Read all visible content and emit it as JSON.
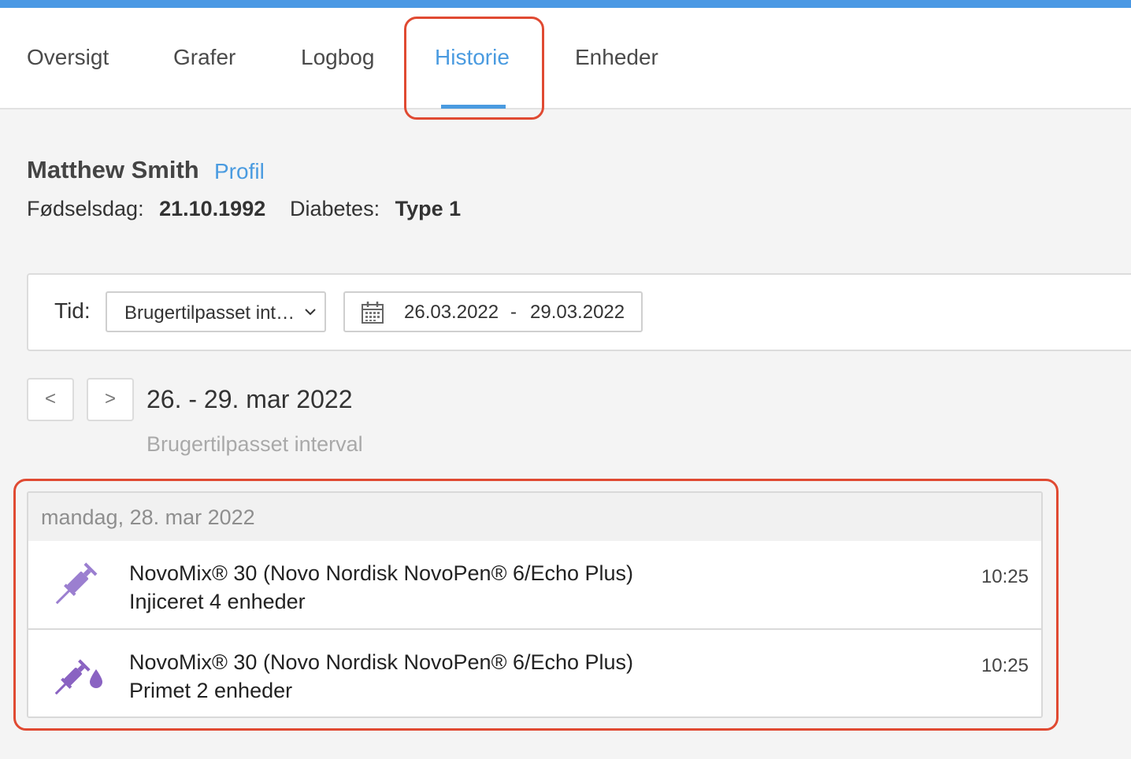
{
  "nav": {
    "tabs": [
      {
        "label": "Oversigt"
      },
      {
        "label": "Grafer"
      },
      {
        "label": "Logbog"
      },
      {
        "label": "Historie"
      },
      {
        "label": "Enheder"
      }
    ],
    "active_tab": "Historie"
  },
  "patient": {
    "name": "Matthew Smith",
    "profile_link": "Profil",
    "birthday_label": "Fødselsdag:",
    "birthday": "21.10.1992",
    "diabetes_label": "Diabetes:",
    "diabetes_type": "Type 1"
  },
  "filter": {
    "time_label": "Tid:",
    "interval_select": "Brugertilpasset interval",
    "date_from": "26.03.2022",
    "date_separator": "-",
    "date_to": "29.03.2022"
  },
  "range": {
    "prev_label": "<",
    "next_label": ">",
    "title": "26. - 29. mar 2022",
    "subtitle": "Brugertilpasset interval"
  },
  "history": {
    "day_header": "mandag, 28. mar 2022",
    "entries": [
      {
        "icon": "syringe-icon",
        "title": "NovoMix® 30 (Novo Nordisk NovoPen® 6/Echo Plus)",
        "detail": "Injiceret 4 enheder",
        "time": "10:25"
      },
      {
        "icon": "syringe-drop-icon",
        "title": "NovoMix® 30 (Novo Nordisk NovoPen® 6/Echo Plus)",
        "detail": "Primet 2 enheder",
        "time": "10:25"
      }
    ]
  },
  "colors": {
    "accent": "#4a9be0",
    "highlight": "#e04a32",
    "icon_injection": "#9b7fd0",
    "icon_priming": "#8a63c2"
  }
}
